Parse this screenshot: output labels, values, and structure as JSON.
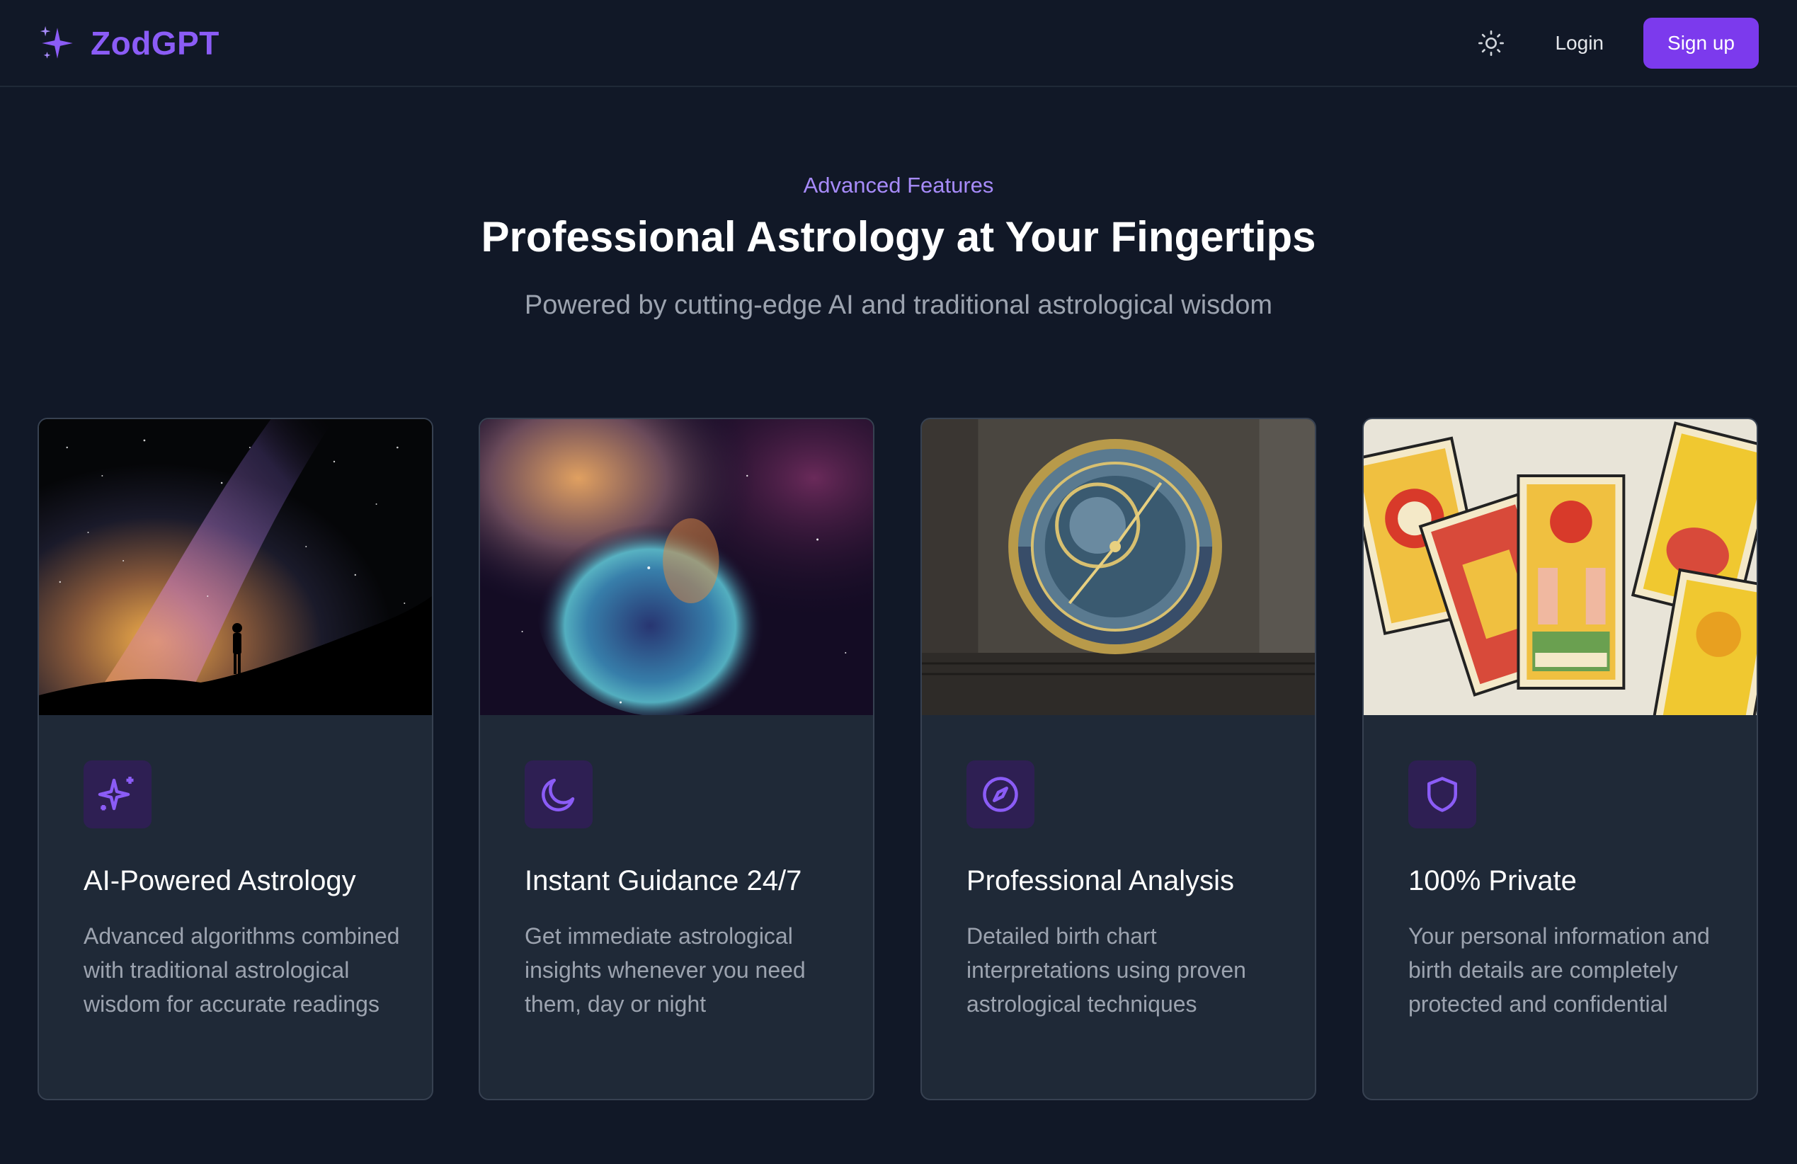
{
  "nav": {
    "brand": "ZodGPT",
    "login_label": "Login",
    "signup_label": "Sign up"
  },
  "hero": {
    "eyebrow": "Advanced Features",
    "title": "Professional Astrology at Your Fingertips",
    "subtitle": "Powered by cutting-edge AI and traditional astrological wisdom"
  },
  "features": [
    {
      "icon": "sparkles-icon",
      "title": "AI-Powered Astrology",
      "description": "Advanced algorithms combined with traditional astrological wisdom for accurate readings"
    },
    {
      "icon": "moon-icon",
      "title": "Instant Guidance 24/7",
      "description": "Get immediate astrological insights whenever you need them, day or night"
    },
    {
      "icon": "compass-icon",
      "title": "Professional Analysis",
      "description": "Detailed birth chart interpretations using proven astrological techniques"
    },
    {
      "icon": "shield-icon",
      "title": "100% Private",
      "description": "Your personal information and birth details are completely protected and confidential"
    }
  ],
  "colors": {
    "background": "#111827",
    "card": "#1f2937",
    "accent": "#7c3aed",
    "accent_light": "#a78bfa"
  }
}
